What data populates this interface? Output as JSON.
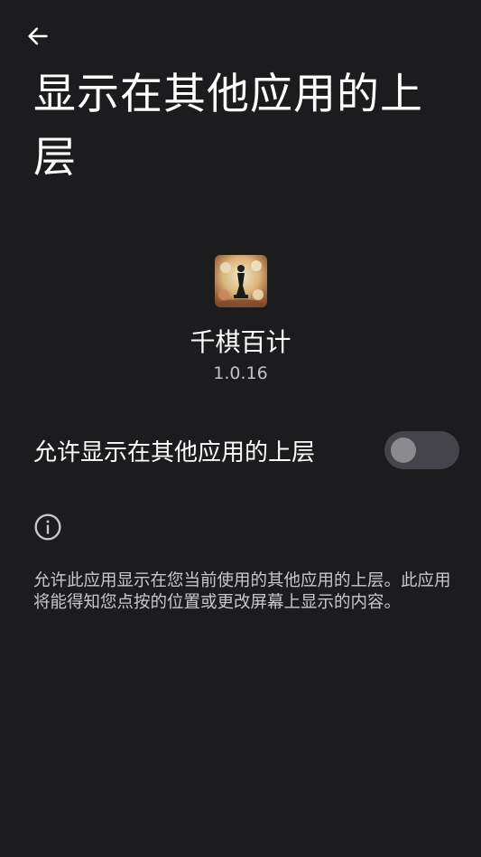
{
  "header": {
    "back_icon": "arrow-left-icon",
    "title": "显示在其他应用的上层"
  },
  "app": {
    "icon": "chess-app-icon",
    "name": "千棋百计",
    "version": "1.0.16"
  },
  "setting": {
    "label": "允许显示在其他应用的上层",
    "enabled": false
  },
  "info": {
    "icon": "info-icon",
    "description": "允许此应用显示在您当前使用的其他应用的上层。此应用将能得知您点按的位置或更改屏幕上显示的内容。"
  },
  "colors": {
    "background": "#1c1c1e",
    "toggle_track_off": "#44444a",
    "toggle_thumb_off": "#8a8a8f",
    "secondary_text": "#c8c8cc"
  }
}
